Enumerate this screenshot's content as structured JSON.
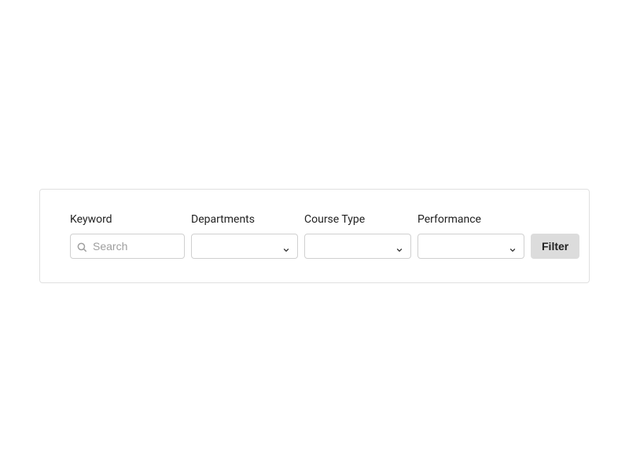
{
  "filters": {
    "keyword": {
      "label": "Keyword",
      "placeholder": "Search",
      "value": ""
    },
    "departments": {
      "label": "Departments",
      "value": ""
    },
    "courseType": {
      "label": "Course Type",
      "value": ""
    },
    "performance": {
      "label": "Performance",
      "value": ""
    },
    "filterButton": "Filter"
  },
  "icons": {
    "search": "search-icon",
    "chevron": "chevron-down-icon"
  }
}
